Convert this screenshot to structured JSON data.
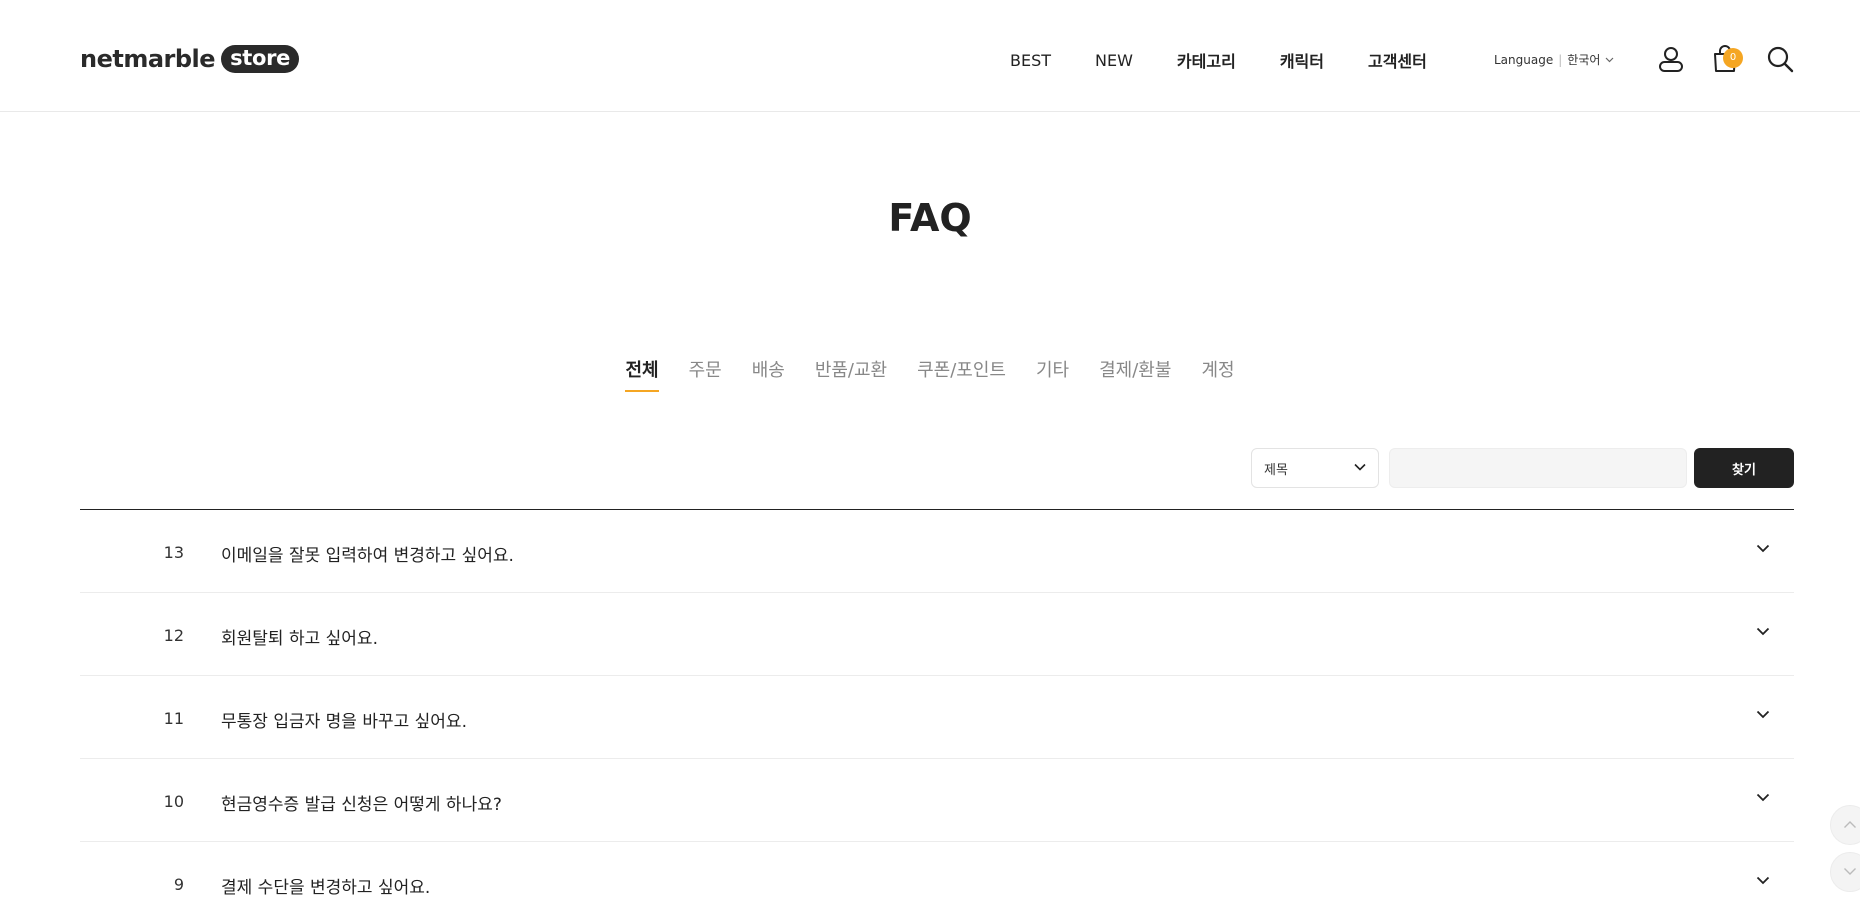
{
  "header": {
    "logo_word": "netmarble",
    "logo_pill": "store",
    "nav": [
      {
        "label": "BEST",
        "bold": false
      },
      {
        "label": "NEW",
        "bold": false
      },
      {
        "label": "카테고리",
        "bold": true
      },
      {
        "label": "캐릭터",
        "bold": true
      },
      {
        "label": "고객센터",
        "bold": true
      }
    ],
    "language_label": "Language",
    "language_separator": "|",
    "language_value": "한국어",
    "cart_count": "0",
    "icons": [
      "user-icon",
      "cart-icon",
      "search-icon"
    ]
  },
  "page": {
    "title": "FAQ"
  },
  "tabs": [
    "전체",
    "주문",
    "배송",
    "반품/교환",
    "쿠폰/포인트",
    "기타",
    "결제/환불",
    "계정"
  ],
  "active_tab": "전체",
  "search": {
    "field_selected": "제목",
    "input_value": "",
    "button_label": "찾기"
  },
  "faq_items": [
    {
      "num": "13",
      "question": "이메일을 잘못 입력하여 변경하고 싶어요."
    },
    {
      "num": "12",
      "question": "회원탈퇴 하고 싶어요."
    },
    {
      "num": "11",
      "question": "무통장 입금자 명을 바꾸고 싶어요."
    },
    {
      "num": "10",
      "question": "현금영수증 발급 신청은 어떻게 하나요?"
    },
    {
      "num": "9",
      "question": "결제 수단을 변경하고 싶어요."
    }
  ],
  "colors": {
    "accent": "#f5a623",
    "dark": "#222222",
    "muted_text": "#888888"
  }
}
